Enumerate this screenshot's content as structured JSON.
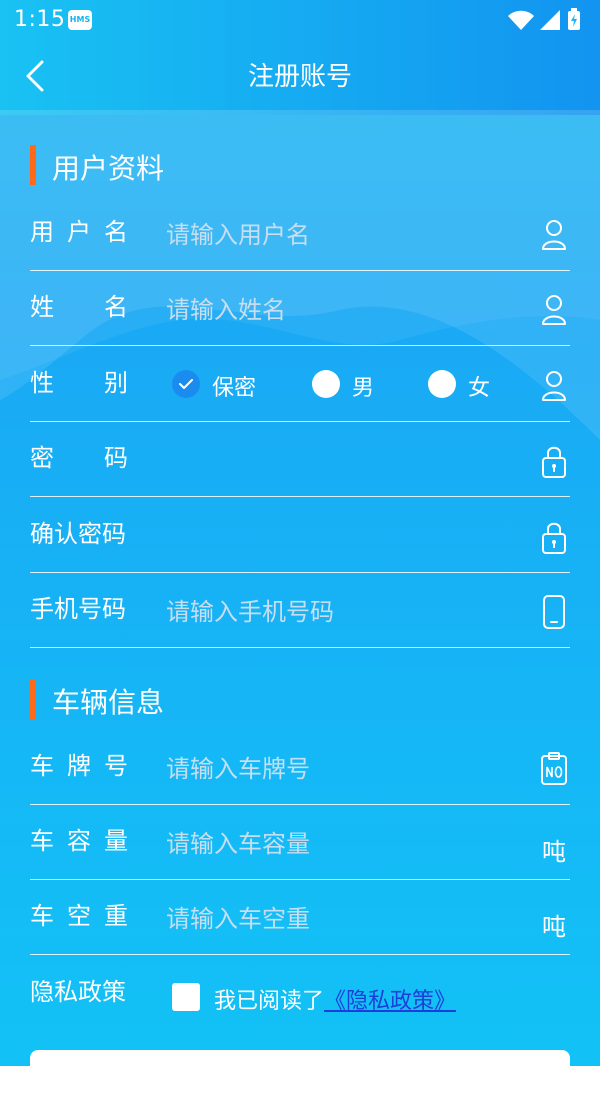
{
  "status_bar": {
    "time": "1:15",
    "badge": "HMS"
  },
  "header": {
    "title": "注册账号"
  },
  "sections": {
    "profile": "用户资料",
    "vehicle": "车辆信息"
  },
  "fields": {
    "username": {
      "label": "用户名",
      "placeholder": "请输入用户名",
      "icon": "user-icon"
    },
    "name": {
      "label": "姓名",
      "placeholder": "请输入姓名",
      "icon": "user-icon"
    },
    "gender": {
      "label": "性别",
      "options": [
        "保密",
        "男",
        "女"
      ],
      "selected": "保密",
      "icon": "user-icon"
    },
    "password": {
      "label": "密码",
      "placeholder": "",
      "icon": "lock-icon"
    },
    "confirm_password": {
      "label": "确认密码",
      "placeholder": "",
      "icon": "lock-icon"
    },
    "phone": {
      "label": "手机号码",
      "placeholder": "请输入手机号码",
      "icon": "phone-icon"
    },
    "plate": {
      "label": "车牌号",
      "placeholder": "请输入车牌号",
      "icon": "plate-no-icon"
    },
    "capacity": {
      "label": "车容量",
      "placeholder": "请输入车容量",
      "unit": "吨"
    },
    "empty_weight": {
      "label": "车空重",
      "placeholder": "请输入车空重",
      "unit": "吨"
    },
    "privacy": {
      "label": "隐私政策",
      "agree_text": "我已阅读了",
      "link_text": "《隐私政策》",
      "checked": false
    }
  },
  "colors": {
    "accent_bar": "#ff6a1a",
    "link": "#1d3fd9",
    "radio_checked": "#1a8cf0"
  }
}
